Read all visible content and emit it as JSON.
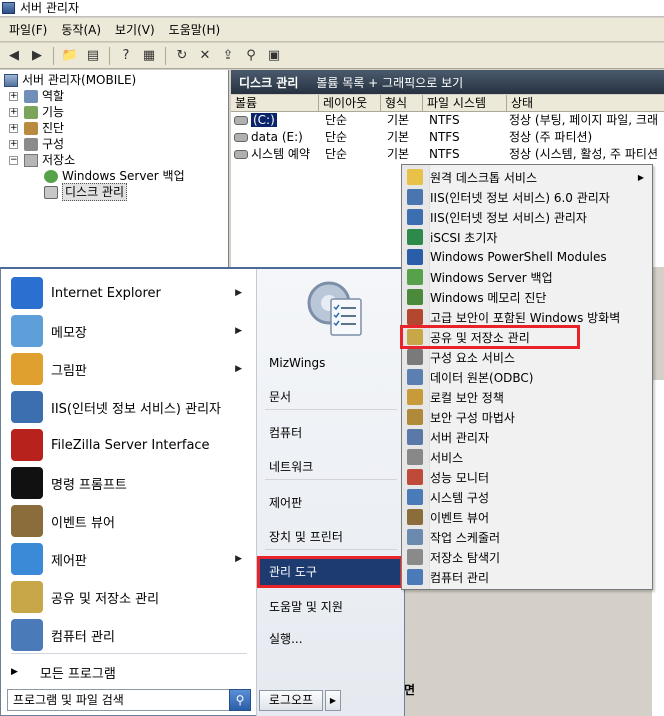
{
  "window": {
    "title": "서버 관리자"
  },
  "menu": [
    "파일(F)",
    "동작(A)",
    "보기(V)",
    "도움말(H)"
  ],
  "toolbar": {
    "icons": [
      "back-icon",
      "forward-icon",
      "up-folder-icon",
      "show-hide-tree-icon",
      "help-icon",
      "properties-icon",
      "refresh-icon",
      "delete-icon",
      "export-icon",
      "search-icon",
      "grid-icon"
    ]
  },
  "tree": {
    "root": "서버 관리자(MOBILE)",
    "items": [
      {
        "label": "역할",
        "expander": "+"
      },
      {
        "label": "기능",
        "expander": "+"
      },
      {
        "label": "진단",
        "expander": "+"
      },
      {
        "label": "구성",
        "expander": "+"
      },
      {
        "label": "저장소",
        "expander": "−"
      }
    ],
    "storage_children": [
      "Windows Server 백업",
      "디스크 관리"
    ]
  },
  "right_header": {
    "title": "디스크 관리",
    "subtitle": "볼륨 목록 + 그래픽으로 보기"
  },
  "volumes": {
    "columns": [
      "볼륨",
      "레이아웃",
      "형식",
      "파일 시스템",
      "상태"
    ],
    "rows": [
      {
        "name": "(C:)",
        "layout": "단순",
        "type": "기본",
        "fs": "NTFS",
        "status": "정상 (부팅, 페이지 파일, 크래"
      },
      {
        "name": "data (E:)",
        "layout": "단순",
        "type": "기본",
        "fs": "NTFS",
        "status": "정상 (주 파티션)"
      },
      {
        "name": "시스템 예약",
        "layout": "단순",
        "type": "기본",
        "fs": "NTFS",
        "status": "정상 (시스템, 활성, 주 파티션"
      }
    ]
  },
  "start_menu": {
    "pinned": [
      {
        "label": "Internet Explorer",
        "icon": "internet-explorer-icon",
        "arrow": true,
        "color": "#2b6fd0"
      },
      {
        "label": "메모장",
        "icon": "notepad-icon",
        "arrow": true,
        "color": "#5f9fd9"
      },
      {
        "label": "그림판",
        "icon": "paint-icon",
        "arrow": true,
        "color": "#e0a030"
      },
      {
        "label": "IIS(인터넷 정보 서비스) 관리자",
        "icon": "iis-icon",
        "arrow": false,
        "color": "#3c6fb0"
      },
      {
        "label": "FileZilla Server Interface",
        "icon": "filezilla-icon",
        "arrow": false,
        "color": "#b8221c"
      },
      {
        "label": "명령 프롬프트",
        "icon": "cmd-icon",
        "arrow": false,
        "color": "#111111"
      },
      {
        "label": "이벤트 뷰어",
        "icon": "event-viewer-icon",
        "arrow": false,
        "color": "#8a6d3b"
      },
      {
        "label": "제어판",
        "icon": "control-panel-icon",
        "arrow": true,
        "color": "#3a8ad8"
      },
      {
        "label": "공유 및 저장소 관리",
        "icon": "share-storage-icon",
        "arrow": false,
        "color": "#c8a748"
      },
      {
        "label": "컴퓨터 관리",
        "icon": "computer-management-icon",
        "arrow": false,
        "color": "#4a7ab8"
      }
    ],
    "all_programs": "모든 프로그램",
    "search_placeholder": "프로그램 및 파일 검색",
    "right_items": [
      "MizWings",
      "문서",
      "컴퓨터",
      "네트워크",
      "제어판",
      "장치 및 프린터",
      "관리 도구",
      "도움말 및 지원",
      "실행..."
    ],
    "highlighted_right": "관리 도구",
    "logoff": "로그오프"
  },
  "admin_tools": {
    "items": [
      {
        "label": "원격 데스크톱 서비스",
        "icon": "folder-icon",
        "arrow": true,
        "color": "#e8c248"
      },
      {
        "label": "IIS(인터넷 정보 서비스) 6.0 관리자",
        "icon": "iis6-icon",
        "arrow": false,
        "color": "#4a76b0"
      },
      {
        "label": "IIS(인터넷 정보 서비스) 관리자",
        "icon": "iis-icon",
        "arrow": false,
        "color": "#3c6fb0"
      },
      {
        "label": "iSCSI 초기자",
        "icon": "iscsi-icon",
        "arrow": false,
        "color": "#2e8a4a"
      },
      {
        "label": "Windows PowerShell Modules",
        "icon": "powershell-icon",
        "arrow": false,
        "color": "#2a5ea8"
      },
      {
        "label": "Windows Server 백업",
        "icon": "backup-icon",
        "arrow": false,
        "color": "#56a14a"
      },
      {
        "label": "Windows 메모리 진단",
        "icon": "memory-diagnostic-icon",
        "arrow": false,
        "color": "#4a8a3a"
      },
      {
        "label": "고급 보안이 포함된 Windows 방화벽",
        "icon": "firewall-icon",
        "arrow": false,
        "color": "#b3472f"
      },
      {
        "label": "공유 및 저장소 관리",
        "icon": "share-storage-icon",
        "arrow": false,
        "color": "#c8a748"
      },
      {
        "label": "구성 요소 서비스",
        "icon": "component-services-icon",
        "arrow": false,
        "color": "#7a7a7a"
      },
      {
        "label": "데이터 원본(ODBC)",
        "icon": "odbc-icon",
        "arrow": false,
        "color": "#5a7fb0"
      },
      {
        "label": "로컬 보안 정책",
        "icon": "security-policy-icon",
        "arrow": false,
        "color": "#c89a3a"
      },
      {
        "label": "보안 구성 마법사",
        "icon": "security-wizard-icon",
        "arrow": false,
        "color": "#b08a3a"
      },
      {
        "label": "서버 관리자",
        "icon": "server-manager-icon",
        "arrow": false,
        "color": "#5a78a8"
      },
      {
        "label": "서비스",
        "icon": "services-icon",
        "arrow": false,
        "color": "#888888"
      },
      {
        "label": "성능 모니터",
        "icon": "performance-monitor-icon",
        "arrow": false,
        "color": "#c04a3a"
      },
      {
        "label": "시스템 구성",
        "icon": "system-config-icon",
        "arrow": false,
        "color": "#4a7ab8"
      },
      {
        "label": "이벤트 뷰어",
        "icon": "event-viewer-icon",
        "arrow": false,
        "color": "#8a6d3b"
      },
      {
        "label": "작업 스케줄러",
        "icon": "task-scheduler-icon",
        "arrow": false,
        "color": "#6a8ab0"
      },
      {
        "label": "저장소 탐색기",
        "icon": "storage-explorer-icon",
        "arrow": false,
        "color": "#8a8a8a"
      },
      {
        "label": "컴퓨터 관리",
        "icon": "computer-management-icon",
        "arrow": false,
        "color": "#4a7ab8"
      }
    ],
    "highlighted": "공유 및 저장소 관리"
  },
  "behind_text": "면"
}
